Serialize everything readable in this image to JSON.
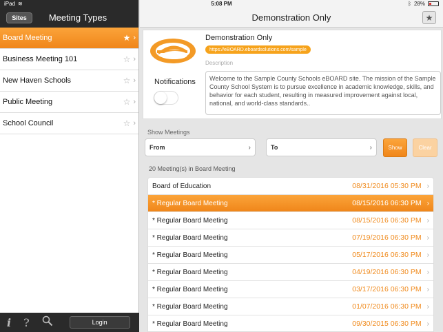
{
  "status_bar": {
    "carrier": "iPad",
    "time": "5:08 PM",
    "battery": "28%"
  },
  "left": {
    "sites_button": "Sites",
    "title": "Meeting Types",
    "items": [
      {
        "label": "Board Meeting",
        "starred": true,
        "active": true
      },
      {
        "label": "Business Meeting 101",
        "starred": false,
        "active": false
      },
      {
        "label": "New Haven Schools",
        "starred": false,
        "active": false
      },
      {
        "label": "Public Meeting",
        "starred": false,
        "active": false
      },
      {
        "label": "School Council",
        "starred": false,
        "active": false
      }
    ],
    "footer": {
      "info_icon": "i",
      "help_icon": "?",
      "login": "Login"
    }
  },
  "right": {
    "title": "Demonstration Only",
    "site": {
      "name": "Demonstration Only",
      "url": "https://eBOARD.eboardsolutions.com/sample",
      "description_label": "Description",
      "description": "Welcome to the Sample County Schools eBOARD site. The mission of the Sample County School System is to pursue excellence in academic knowledge, skills, and behavior for each student, resulting in measured improvement against local, national, and world-class standards..",
      "notifications_label": "Notifications",
      "notifications_on": false
    },
    "show_meetings": {
      "label": "Show Meetings",
      "from": "From",
      "to": "To",
      "show": "Show",
      "clear": "Clear"
    },
    "count_label": "20 Meeting(s) in Board Meeting",
    "meetings": [
      {
        "name": "Board of Education",
        "date": "08/31/2016 05:30 PM"
      },
      {
        "name": "* Regular Board Meeting",
        "date": "08/15/2016 06:30 PM"
      },
      {
        "name": "* Regular Board Meeting",
        "date": "08/15/2016 06:30 PM"
      },
      {
        "name": "* Regular Board Meeting",
        "date": "07/19/2016 06:30 PM"
      },
      {
        "name": "* Regular Board Meeting",
        "date": "05/17/2016 06:30 PM"
      },
      {
        "name": "* Regular Board Meeting",
        "date": "04/19/2016 06:30 PM"
      },
      {
        "name": "* Regular Board Meeting",
        "date": "03/17/2016 06:30 PM"
      },
      {
        "name": "* Regular Board Meeting",
        "date": "01/07/2016 06:30 PM"
      },
      {
        "name": "* Regular Board Meeting",
        "date": "09/30/2015 06:30 PM"
      }
    ],
    "active_meeting_index": 1
  },
  "colors": {
    "accent": "#f0861a",
    "dark_bar": "#2a2a2a"
  }
}
